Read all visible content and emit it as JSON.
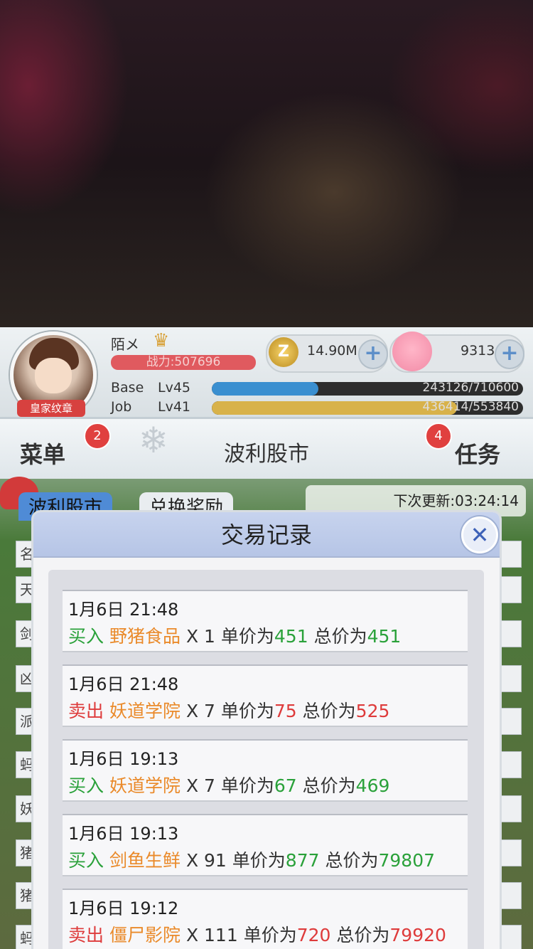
{
  "player": {
    "name": "陌メ",
    "power_label": "战力:507696",
    "badge": "皇家纹章"
  },
  "currency": {
    "zeny": "14.90M",
    "gems": "9313"
  },
  "stats": {
    "base_label": "Base",
    "base_level": "Lv45",
    "base_exp": "243126/710600",
    "base_progress": 0.342,
    "job_label": "Job",
    "job_level": "Lv41",
    "job_exp": "436414/553840",
    "job_progress": 0.788
  },
  "nav": {
    "menu_label": "菜单",
    "menu_badge": "2",
    "title": "波利股市",
    "tasks_label": "任务",
    "tasks_badge": "4"
  },
  "tabs": {
    "tab1": "波利股市",
    "tab2": "兑换奖励"
  },
  "refresh_label": "下次更新:03:24:14",
  "sidebar_chars": [
    "名",
    "天",
    "剑",
    "凶",
    "派",
    "蚂",
    "妖",
    "猪",
    "猪",
    "蚂"
  ],
  "modal": {
    "title": "交易记录",
    "close_label": "✕",
    "unit_price_label": "单价为",
    "total_price_label": "总价为",
    "records": [
      {
        "time": "1月6日 21:48",
        "action": "买入",
        "item": "野猪食品",
        "qty": "X 1",
        "unit": "451",
        "total": "451"
      },
      {
        "time": "1月6日 21:48",
        "action": "卖出",
        "item": "妖道学院",
        "qty": "X 7",
        "unit": "75",
        "total": "525"
      },
      {
        "time": "1月6日 19:13",
        "action": "买入",
        "item": "妖道学院",
        "qty": "X 7",
        "unit": "67",
        "total": "469"
      },
      {
        "time": "1月6日 19:13",
        "action": "买入",
        "item": "剑鱼生鲜",
        "qty": "X 91",
        "unit": "877",
        "total": "79807"
      },
      {
        "time": "1月6日 19:12",
        "action": "卖出",
        "item": "僵尸影院",
        "qty": "X 111",
        "unit": "720",
        "total": "79920"
      }
    ]
  },
  "colors": {
    "buy": "#2aa13a",
    "sell": "#de3b3b",
    "item": "#ea8a2a",
    "base_bar": "#3a8fd0",
    "job_bar": "#d8b24a"
  }
}
